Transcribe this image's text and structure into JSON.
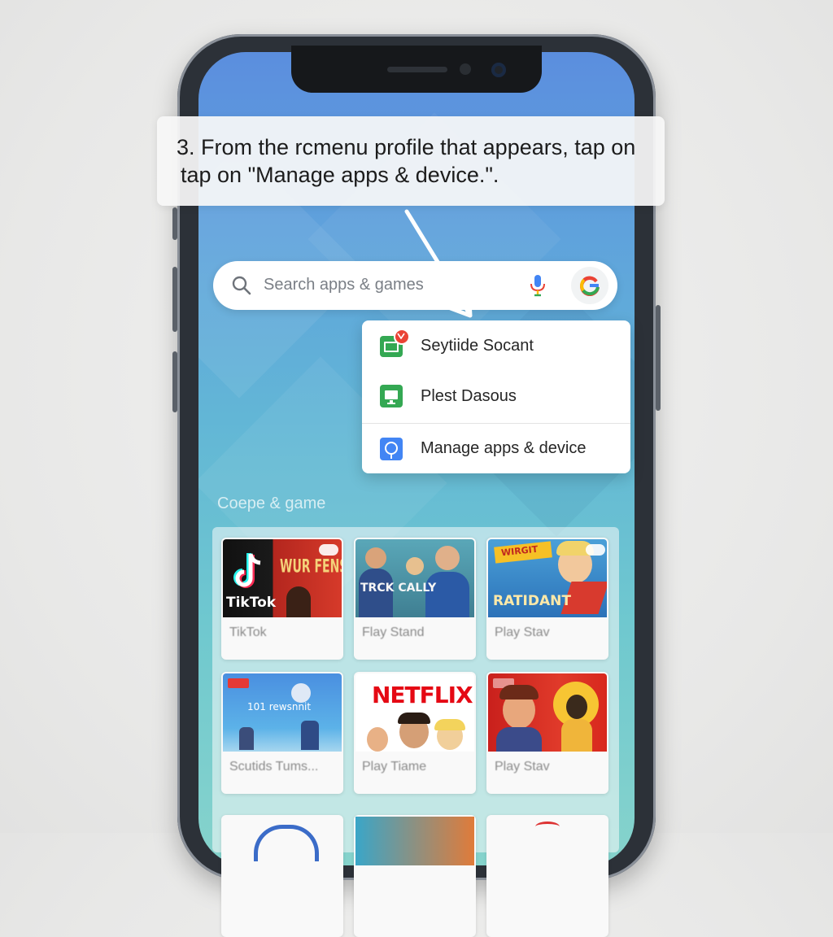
{
  "caption": {
    "line1": "3. From the rcmenu profile that appears, tap on",
    "line2": "tap on \"Manage apps & device.\"."
  },
  "search": {
    "placeholder": "Search apps & games",
    "icons": [
      "search-icon",
      "mic-icon",
      "google-account-icon"
    ]
  },
  "menu": {
    "items": [
      {
        "label": "Seytiide Socant",
        "icon": "green-screen-badge-icon"
      },
      {
        "label": "Plest Dasous",
        "icon": "green-monitor-icon"
      },
      {
        "label": "Manage apps & device",
        "icon": "blue-circle-icon"
      }
    ]
  },
  "section": {
    "title": "Coepe & game"
  },
  "apps": [
    {
      "label": "TikTok",
      "thumb_text": "TikTok",
      "thumb_text2": "WUR FENS"
    },
    {
      "label": "Flay Stand",
      "thumb_text": "TRCK CALLY"
    },
    {
      "label": "Play Stav",
      "thumb_text": "RATIDANT",
      "thumb_text2": "WIRGIT"
    },
    {
      "label": "Scutids Tums...",
      "thumb_text": "101 rewsnnit"
    },
    {
      "label": "Play Tiame",
      "thumb_text": "NETFLIX"
    },
    {
      "label": "Play Stav",
      "thumb_text": ""
    }
  ],
  "colors": {
    "screen_top": "#5b8ede",
    "screen_bottom": "#86d3cc",
    "green_icon": "#34a853",
    "blue_icon": "#4285f4",
    "badge_red": "#ea4335",
    "netflix_red": "#e50914"
  }
}
